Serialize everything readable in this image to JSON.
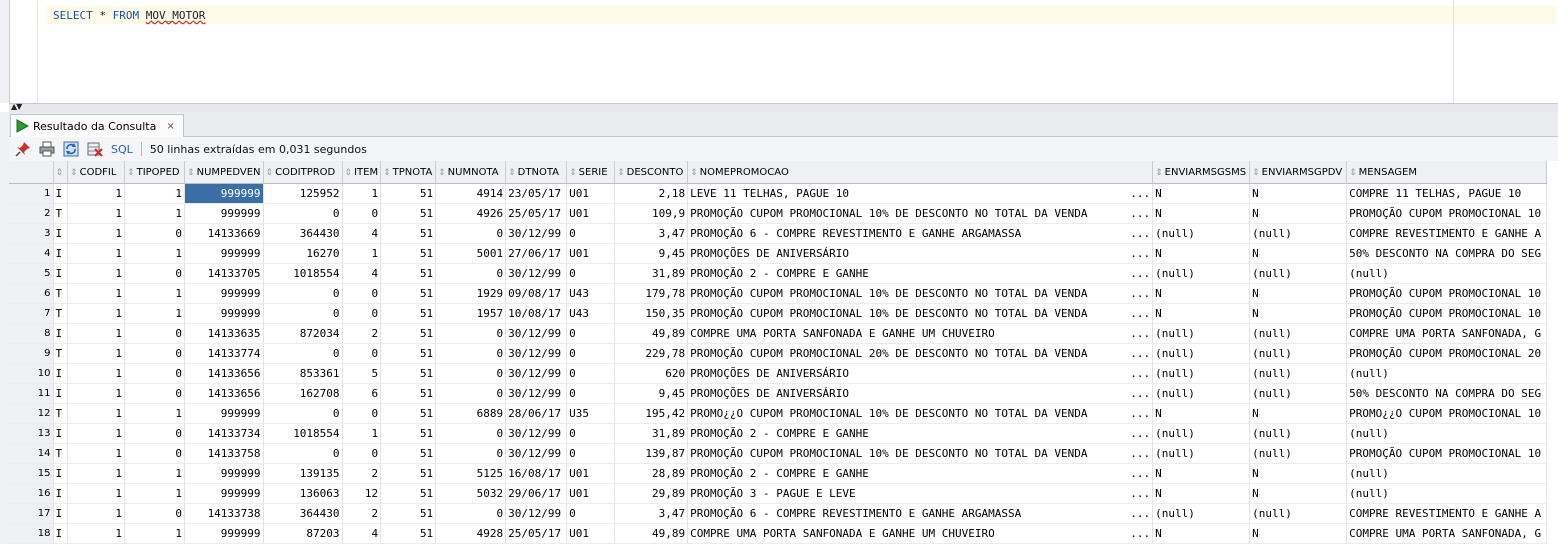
{
  "editor": {
    "sql_keyword1": "SELECT",
    "sql_star": "*",
    "sql_keyword2": "FROM",
    "sql_table": "MOV_MOTOR"
  },
  "results_tab": {
    "label": "Resultado da Consulta",
    "close": "×"
  },
  "toolbar": {
    "icons": [
      "pin-icon",
      "print-icon",
      "refresh-icon",
      "delete-icon"
    ],
    "sql_label": "SQL",
    "message": "50 linhas extraídas em 0,031 segundos"
  },
  "grid": {
    "columns": [
      "CODFIL",
      "TIPOPED",
      "NUMPEDVEN",
      "CODITPROD",
      "ITEM",
      "TPNOTA",
      "NUMNOTA",
      "DTNOTA",
      "SERIE",
      "DESCONTO",
      "NOMEPROMOCAO",
      "ENVIARMSGSMS",
      "ENVIARMSGPDV",
      "MENSAGEM"
    ],
    "truncation_marker": "...",
    "rows": [
      [
        "1",
        "I",
        "1",
        "1",
        "999999",
        "125952",
        "1",
        "51",
        "4914",
        "23/05/17",
        "U01",
        "2,18",
        "LEVE 11 TELHAS, PAGUE 10",
        "N",
        "N",
        "COMPRE 11 TELHAS, PAGUE 10"
      ],
      [
        "2",
        "T",
        "1",
        "1",
        "999999",
        "0",
        "0",
        "51",
        "4926",
        "25/05/17",
        "U01",
        "109,9",
        "PROMOÇÃO CUPOM PROMOCIONAL 10% DE DESCONTO NO TOTAL DA VENDA",
        "N",
        "N",
        "PROMOÇÃO CUPOM PROMOCIONAL 10"
      ],
      [
        "3",
        "I",
        "1",
        "0",
        "14133669",
        "364430",
        "4",
        "51",
        "0",
        "30/12/99",
        "0",
        "3,47",
        "PROMOÇÃO 6 - COMPRE REVESTIMENTO E GANHE ARGAMASSA",
        "(null)",
        "(null)",
        "COMPRE REVESTIMENTO E GANHE A"
      ],
      [
        "4",
        "I",
        "1",
        "1",
        "999999",
        "16270",
        "1",
        "51",
        "5001",
        "27/06/17",
        "U01",
        "9,45",
        "PROMOÇÕES DE ANIVERSÁRIO",
        "N",
        "N",
        "50% DESCONTO NA COMPRA DO SEG"
      ],
      [
        "5",
        "I",
        "1",
        "0",
        "14133705",
        "1018554",
        "4",
        "51",
        "0",
        "30/12/99",
        "0",
        "31,89",
        "PROMOÇÃO 2 - COMPRE E GANHE",
        "(null)",
        "(null)",
        "(null)"
      ],
      [
        "6",
        "T",
        "1",
        "1",
        "999999",
        "0",
        "0",
        "51",
        "1929",
        "09/08/17",
        "U43",
        "179,78",
        "PROMOÇÃO CUPOM PROMOCIONAL 10% DE DESCONTO NO TOTAL DA VENDA",
        "N",
        "N",
        "PROMOÇÃO CUPOM PROMOCIONAL 10"
      ],
      [
        "7",
        "T",
        "1",
        "1",
        "999999",
        "0",
        "0",
        "51",
        "1957",
        "10/08/17",
        "U43",
        "150,35",
        "PROMOÇÃO CUPOM PROMOCIONAL 10% DE DESCONTO NO TOTAL DA VENDA",
        "N",
        "N",
        "PROMOÇÃO CUPOM PROMOCIONAL 10"
      ],
      [
        "8",
        "I",
        "1",
        "0",
        "14133635",
        "872034",
        "2",
        "51",
        "0",
        "30/12/99",
        "0",
        "49,89",
        "COMPRE UMA PORTA SANFONADA E GANHE UM CHUVEIRO",
        "(null)",
        "(null)",
        "COMPRE UMA PORTA SANFONADA, G"
      ],
      [
        "9",
        "T",
        "1",
        "0",
        "14133774",
        "0",
        "0",
        "51",
        "0",
        "30/12/99",
        "0",
        "229,78",
        "PROMOÇÃO CUPOM PROMOCIONAL 20% DE DESCONTO NO TOTAL DA VENDA",
        "(null)",
        "(null)",
        "PROMOÇÃO CUPOM PROMOCIONAL 20"
      ],
      [
        "10",
        "I",
        "1",
        "0",
        "14133656",
        "853361",
        "5",
        "51",
        "0",
        "30/12/99",
        "0",
        "620",
        "PROMOÇÕES DE ANIVERSÁRIO",
        "(null)",
        "(null)",
        "(null)"
      ],
      [
        "11",
        "I",
        "1",
        "0",
        "14133656",
        "162708",
        "6",
        "51",
        "0",
        "30/12/99",
        "0",
        "9,45",
        "PROMOÇÕES DE ANIVERSÁRIO",
        "(null)",
        "(null)",
        "50% DESCONTO NA COMPRA DO SEG"
      ],
      [
        "12",
        "T",
        "1",
        "1",
        "999999",
        "0",
        "0",
        "51",
        "6889",
        "28/06/17",
        "U35",
        "195,42",
        "PROMO¿¿O CUPOM PROMOCIONAL 10% DE DESCONTO NO TOTAL DA VENDA",
        "N",
        "N",
        "PROMO¿¿O CUPOM PROMOCIONAL 10"
      ],
      [
        "13",
        "I",
        "1",
        "0",
        "14133734",
        "1018554",
        "1",
        "51",
        "0",
        "30/12/99",
        "0",
        "31,89",
        "PROMOÇÃO 2 - COMPRE E GANHE",
        "(null)",
        "(null)",
        "(null)"
      ],
      [
        "14",
        "T",
        "1",
        "0",
        "14133758",
        "0",
        "0",
        "51",
        "0",
        "30/12/99",
        "0",
        "139,87",
        "PROMOÇÃO CUPOM PROMOCIONAL 10% DE DESCONTO NO TOTAL DA VENDA",
        "(null)",
        "(null)",
        "PROMOÇÃO CUPOM PROMOCIONAL 10"
      ],
      [
        "15",
        "I",
        "1",
        "1",
        "999999",
        "139135",
        "2",
        "51",
        "5125",
        "16/08/17",
        "U01",
        "28,89",
        "PROMOÇÃO 2 - COMPRE E GANHE",
        "N",
        "N",
        "(null)"
      ],
      [
        "16",
        "I",
        "1",
        "1",
        "999999",
        "136063",
        "12",
        "51",
        "5032",
        "29/06/17",
        "U01",
        "29,89",
        "PROMOÇÃO 3 - PAGUE E LEVE",
        "N",
        "N",
        "(null)"
      ],
      [
        "17",
        "I",
        "1",
        "0",
        "14133738",
        "364430",
        "2",
        "51",
        "0",
        "30/12/99",
        "0",
        "3,47",
        "PROMOÇÃO 6 - COMPRE REVESTIMENTO E GANHE ARGAMASSA",
        "(null)",
        "(null)",
        "COMPRE REVESTIMENTO E GANHE A"
      ],
      [
        "18",
        "I",
        "1",
        "1",
        "999999",
        "87203",
        "4",
        "51",
        "4928",
        "25/05/17",
        "U01",
        "49,89",
        "COMPRE UMA PORTA SANFONADA E GANHE UM CHUVEIRO",
        "N",
        "N",
        "COMPRE UMA PORTA SANFONADA, G"
      ]
    ]
  }
}
